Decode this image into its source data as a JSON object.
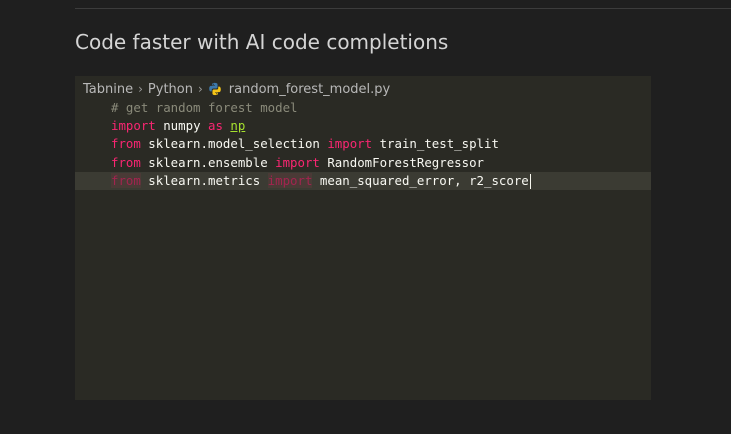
{
  "heading": "Code faster with AI code completions",
  "breadcrumb": {
    "root": "Tabnine",
    "folder": "Python",
    "file": "random_forest_model.py",
    "separator": "›"
  },
  "code": {
    "line1": {
      "comment": "# get random forest model"
    },
    "line2": {
      "kw": "import",
      "module": " numpy ",
      "kw2": "as",
      "space": " ",
      "alias": "np"
    },
    "line3": {
      "kw": "from",
      "module": " sklearn.model_selection ",
      "kw2": "import",
      "rest": " train_test_split"
    },
    "line4": {
      "kw": "from",
      "module": " sklearn.ensemble ",
      "kw2": "import",
      "rest": " RandomForestRegressor"
    },
    "line5": {
      "kw": "from",
      "module": " sklearn.metrics ",
      "kw2": "import",
      "rest": " mean_squared_error, r2_score"
    }
  },
  "colors": {
    "background": "#1f1f1f",
    "editor_background": "#2a2a24",
    "keyword": "#f92672",
    "alias": "#a6e22e",
    "comment": "#8a8a7a"
  },
  "icons": {
    "file_type": "python-icon"
  }
}
